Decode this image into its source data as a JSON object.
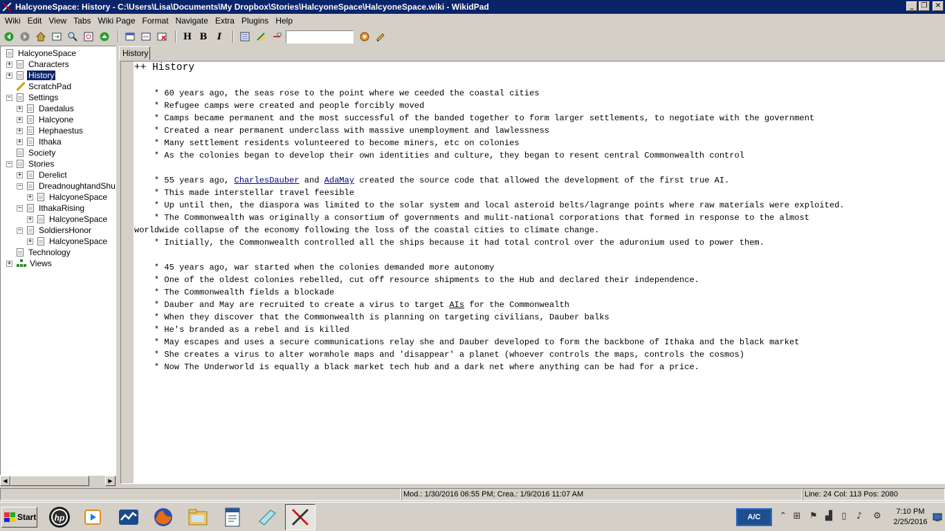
{
  "window": {
    "title": "HalcyoneSpace: History - C:\\Users\\Lisa\\Documents\\My Dropbox\\Stories\\HalcyoneSpace\\HalcyoneSpace.wiki - WikidPad",
    "minimize_glyph": "_",
    "maximize_glyph": "❐",
    "close_glyph": "✕"
  },
  "menubar": {
    "items": [
      "Wiki",
      "Edit",
      "View",
      "Tabs",
      "Wiki Page",
      "Format",
      "Navigate",
      "Extra",
      "Plugins",
      "Help"
    ]
  },
  "toolbar": {
    "heading_label": "H",
    "bold_label": "B",
    "italic_label": "I",
    "search_value": "",
    "icons": [
      "back-icon",
      "forward-icon",
      "home-icon",
      "goto-page-icon",
      "find-icon",
      "zoom-icon",
      "up-icon",
      "new-tab-icon",
      "new-window-icon",
      "close-tab-icon",
      "insert-icon",
      "attach-icon",
      "remove-icon",
      "search-go-icon",
      "wiki-word-icon"
    ]
  },
  "tree": {
    "nodes": [
      {
        "label": "HalcyoneSpace",
        "expander": "",
        "icon": "page"
      },
      {
        "label": "Characters",
        "expander": "+",
        "icon": "page"
      },
      {
        "label": "History",
        "expander": "+",
        "icon": "page",
        "selected": true
      },
      {
        "label": "ScratchPad",
        "expander": "",
        "icon": "pencil"
      },
      {
        "label": "Settings",
        "expander": "−",
        "icon": "page"
      },
      {
        "label": "Daedalus",
        "expander": "+",
        "icon": "page"
      },
      {
        "label": "Halcyone",
        "expander": "+",
        "icon": "page"
      },
      {
        "label": "Hephaestus",
        "expander": "+",
        "icon": "page"
      },
      {
        "label": "Ithaka",
        "expander": "+",
        "icon": "page"
      },
      {
        "label": "Society",
        "expander": "",
        "icon": "page"
      },
      {
        "label": "Stories",
        "expander": "−",
        "icon": "page"
      },
      {
        "label": "Derelict",
        "expander": "+",
        "icon": "page"
      },
      {
        "label": "DreadnoughtandShut",
        "expander": "−",
        "icon": "page"
      },
      {
        "label": "HalcyoneSpace",
        "expander": "+",
        "icon": "page"
      },
      {
        "label": "IthakaRising",
        "expander": "−",
        "icon": "page"
      },
      {
        "label": "HalcyoneSpace",
        "expander": "+",
        "icon": "page"
      },
      {
        "label": "SoldiersHonor",
        "expander": "−",
        "icon": "page"
      },
      {
        "label": "HalcyoneSpace",
        "expander": "+",
        "icon": "page"
      },
      {
        "label": "Technology",
        "expander": "",
        "icon": "page"
      },
      {
        "label": "Views",
        "expander": "+",
        "icon": "views"
      }
    ]
  },
  "tabs": {
    "active": "History"
  },
  "editor": {
    "heading": "++ History",
    "lines": [
      "    * 60 years ago, the seas rose to the point where we ceeded the coastal cities",
      "    * Refugee camps were created and people forcibly moved",
      "    * Camps became permanent and the most successful of the banded together to form larger settlements, to negotiate with the government",
      "    * Created a near permanent underclass with massive unemployment and lawlessness",
      "    * Many settlement residents volunteered to become miners, etc on colonies",
      "    * As the colonies began to develop their own identities and culture, they began to resent central Commonwealth control",
      "",
      "",
      "    * This made interstellar travel feesible",
      "    * Up until then, the diaspora was limited to the solar system and local asteroid belts/lagrange points where raw materials were exploited.",
      "    * The Commonwealth was originally a consortium of governments and mulit-national corporations that formed in response to the almost",
      "worldwide collapse of the economy following the loss of the coastal cities to climate change.",
      "    * Initially, the Commonwealth controlled all the ships because it had total control over the aduronium used to power them.",
      "",
      "    * 45 years ago, war started when the colonies demanded more autonomy",
      "    * One of the oldest colonies rebelled, cut off resource shipments to the Hub and declared their independence.",
      "    * The Commonwealth fields a blockade",
      "",
      "    * When they discover that the Commonwealth is planning on targeting civilians, Dauber balks",
      "    * He's branded as a rebel and is killed",
      "    * May escapes and uses a secure communications relay she and Dauber developed to form the backbone of Ithaka and the black market",
      "    * She creates a virus to alter wormhole maps and 'disappear' a planet (whoever controls the maps, controls the cosmos)",
      "    * Now The Underworld is equally a black market tech hub and a dark net where anything can be had for a price."
    ],
    "line55_prefix": "    * 55 years ago, ",
    "link_charles": "CharlesDauber",
    "line55_and": " and ",
    "link_ada": "AdaMay",
    "line55_suffix": " created the source code that allowed the development of the first true AI.",
    "dauber_prefix": "    * Dauber and May are recruited to create a virus to target ",
    "dauber_link": "AIs",
    "dauber_suffix": " for the Commonwealth"
  },
  "statusbar": {
    "left": "",
    "dates": "Mod.: 1/30/2016 06:55 PM; Crea.: 1/9/2016 11:07 AM",
    "position": "Line: 24 Col: 113 Pos: 2080"
  },
  "taskbar": {
    "start_label": "Start",
    "ac_label": "A/C",
    "clock_time": "7:10 PM",
    "clock_date": "2/25/2016",
    "buttons": [
      "hp-icon",
      "media-icon",
      "stock-icon",
      "firefox-icon",
      "explorer-icon",
      "document-icon",
      "notepad-icon",
      "wikidpad-icon"
    ]
  }
}
